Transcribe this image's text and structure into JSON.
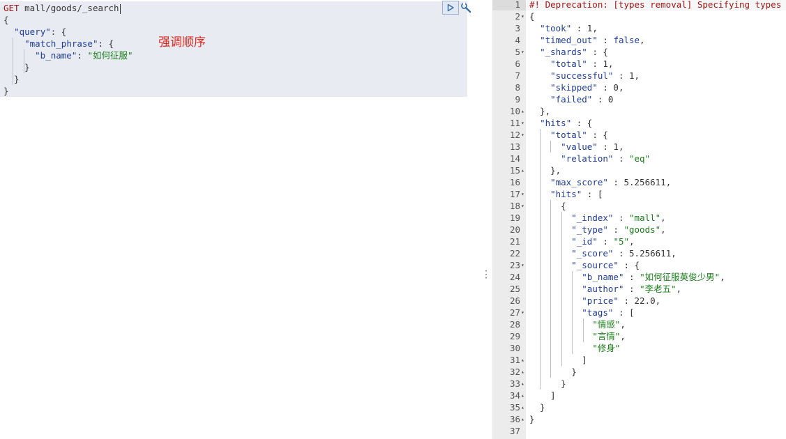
{
  "request": {
    "method": "GET",
    "path": "mall/goods/_search",
    "body_lines": [
      [
        {
          "t": "punc",
          "v": "{"
        }
      ],
      [
        {
          "t": "punc",
          "v": "  "
        },
        {
          "t": "key",
          "v": "\"query\""
        },
        {
          "t": "punc",
          "v": ": {"
        }
      ],
      [
        {
          "t": "punc",
          "v": "    "
        },
        {
          "t": "key",
          "v": "\"match_phrase\""
        },
        {
          "t": "punc",
          "v": ": {"
        }
      ],
      [
        {
          "t": "punc",
          "v": "      "
        },
        {
          "t": "key",
          "v": "\"b_name\""
        },
        {
          "t": "punc",
          "v": ": "
        },
        {
          "t": "str",
          "v": "\"如何征服\""
        }
      ],
      [
        {
          "t": "punc",
          "v": "    }"
        }
      ],
      [
        {
          "t": "punc",
          "v": "  }"
        }
      ],
      [
        {
          "t": "punc",
          "v": "}"
        }
      ]
    ]
  },
  "annotation": "强调顺序",
  "toolbar": {
    "run_icon": "play-icon",
    "settings_icon": "wrench-icon"
  },
  "colors": {
    "method": "#a31515",
    "key": "#1f3d99",
    "string": "#1a7f1a",
    "annotation": "#e0281f"
  },
  "response": {
    "lines": [
      {
        "n": "1",
        "f": "",
        "tokens": [
          {
            "t": "comment",
            "v": "#! Deprecation: [types removal] Specifying types in search requests is deprecated."
          }
        ]
      },
      {
        "n": "2",
        "f": "▾",
        "tokens": [
          {
            "t": "punc",
            "v": "{"
          }
        ]
      },
      {
        "n": "3",
        "f": "",
        "tokens": [
          {
            "t": "punc",
            "v": "  "
          },
          {
            "t": "key",
            "v": "\"took\""
          },
          {
            "t": "punc",
            "v": " : "
          },
          {
            "t": "num",
            "v": "1"
          },
          {
            "t": "punc",
            "v": ","
          }
        ]
      },
      {
        "n": "4",
        "f": "",
        "tokens": [
          {
            "t": "punc",
            "v": "  "
          },
          {
            "t": "key",
            "v": "\"timed_out\""
          },
          {
            "t": "punc",
            "v": " : "
          },
          {
            "t": "bool",
            "v": "false"
          },
          {
            "t": "punc",
            "v": ","
          }
        ]
      },
      {
        "n": "5",
        "f": "▾",
        "tokens": [
          {
            "t": "punc",
            "v": "  "
          },
          {
            "t": "key",
            "v": "\"_shards\""
          },
          {
            "t": "punc",
            "v": " : {"
          }
        ]
      },
      {
        "n": "6",
        "f": "",
        "tokens": [
          {
            "t": "punc",
            "v": "    "
          },
          {
            "t": "key",
            "v": "\"total\""
          },
          {
            "t": "punc",
            "v": " : "
          },
          {
            "t": "num",
            "v": "1"
          },
          {
            "t": "punc",
            "v": ","
          }
        ]
      },
      {
        "n": "7",
        "f": "",
        "tokens": [
          {
            "t": "punc",
            "v": "    "
          },
          {
            "t": "key",
            "v": "\"successful\""
          },
          {
            "t": "punc",
            "v": " : "
          },
          {
            "t": "num",
            "v": "1"
          },
          {
            "t": "punc",
            "v": ","
          }
        ]
      },
      {
        "n": "8",
        "f": "",
        "tokens": [
          {
            "t": "punc",
            "v": "    "
          },
          {
            "t": "key",
            "v": "\"skipped\""
          },
          {
            "t": "punc",
            "v": " : "
          },
          {
            "t": "num",
            "v": "0"
          },
          {
            "t": "punc",
            "v": ","
          }
        ]
      },
      {
        "n": "9",
        "f": "",
        "tokens": [
          {
            "t": "punc",
            "v": "    "
          },
          {
            "t": "key",
            "v": "\"failed\""
          },
          {
            "t": "punc",
            "v": " : "
          },
          {
            "t": "num",
            "v": "0"
          }
        ]
      },
      {
        "n": "10",
        "f": "▴",
        "tokens": [
          {
            "t": "punc",
            "v": "  },"
          }
        ]
      },
      {
        "n": "11",
        "f": "▾",
        "tokens": [
          {
            "t": "punc",
            "v": "  "
          },
          {
            "t": "key",
            "v": "\"hits\""
          },
          {
            "t": "punc",
            "v": " : {"
          }
        ]
      },
      {
        "n": "12",
        "f": "▾",
        "tokens": [
          {
            "t": "punc",
            "v": "    "
          },
          {
            "t": "key",
            "v": "\"total\""
          },
          {
            "t": "punc",
            "v": " : {"
          }
        ]
      },
      {
        "n": "13",
        "f": "",
        "tokens": [
          {
            "t": "punc",
            "v": "      "
          },
          {
            "t": "key",
            "v": "\"value\""
          },
          {
            "t": "punc",
            "v": " : "
          },
          {
            "t": "num",
            "v": "1"
          },
          {
            "t": "punc",
            "v": ","
          }
        ]
      },
      {
        "n": "14",
        "f": "",
        "tokens": [
          {
            "t": "punc",
            "v": "      "
          },
          {
            "t": "key",
            "v": "\"relation\""
          },
          {
            "t": "punc",
            "v": " : "
          },
          {
            "t": "str",
            "v": "\"eq\""
          }
        ]
      },
      {
        "n": "15",
        "f": "▴",
        "tokens": [
          {
            "t": "punc",
            "v": "    },"
          }
        ]
      },
      {
        "n": "16",
        "f": "",
        "tokens": [
          {
            "t": "punc",
            "v": "    "
          },
          {
            "t": "key",
            "v": "\"max_score\""
          },
          {
            "t": "punc",
            "v": " : "
          },
          {
            "t": "num",
            "v": "5.256611"
          },
          {
            "t": "punc",
            "v": ","
          }
        ]
      },
      {
        "n": "17",
        "f": "▾",
        "tokens": [
          {
            "t": "punc",
            "v": "    "
          },
          {
            "t": "key",
            "v": "\"hits\""
          },
          {
            "t": "punc",
            "v": " : ["
          }
        ]
      },
      {
        "n": "18",
        "f": "▾",
        "tokens": [
          {
            "t": "punc",
            "v": "      {"
          }
        ]
      },
      {
        "n": "19",
        "f": "",
        "tokens": [
          {
            "t": "punc",
            "v": "        "
          },
          {
            "t": "key",
            "v": "\"_index\""
          },
          {
            "t": "punc",
            "v": " : "
          },
          {
            "t": "str",
            "v": "\"mall\""
          },
          {
            "t": "punc",
            "v": ","
          }
        ]
      },
      {
        "n": "20",
        "f": "",
        "tokens": [
          {
            "t": "punc",
            "v": "        "
          },
          {
            "t": "key",
            "v": "\"_type\""
          },
          {
            "t": "punc",
            "v": " : "
          },
          {
            "t": "str",
            "v": "\"goods\""
          },
          {
            "t": "punc",
            "v": ","
          }
        ]
      },
      {
        "n": "21",
        "f": "",
        "tokens": [
          {
            "t": "punc",
            "v": "        "
          },
          {
            "t": "key",
            "v": "\"_id\""
          },
          {
            "t": "punc",
            "v": " : "
          },
          {
            "t": "str",
            "v": "\"5\""
          },
          {
            "t": "punc",
            "v": ","
          }
        ]
      },
      {
        "n": "22",
        "f": "",
        "tokens": [
          {
            "t": "punc",
            "v": "        "
          },
          {
            "t": "key",
            "v": "\"_score\""
          },
          {
            "t": "punc",
            "v": " : "
          },
          {
            "t": "num",
            "v": "5.256611"
          },
          {
            "t": "punc",
            "v": ","
          }
        ]
      },
      {
        "n": "23",
        "f": "▾",
        "tokens": [
          {
            "t": "punc",
            "v": "        "
          },
          {
            "t": "key",
            "v": "\"_source\""
          },
          {
            "t": "punc",
            "v": " : {"
          }
        ]
      },
      {
        "n": "24",
        "f": "",
        "tokens": [
          {
            "t": "punc",
            "v": "          "
          },
          {
            "t": "key",
            "v": "\"b_name\""
          },
          {
            "t": "punc",
            "v": " : "
          },
          {
            "t": "str",
            "v": "\"如何征服英俊少男\""
          },
          {
            "t": "punc",
            "v": ","
          }
        ]
      },
      {
        "n": "25",
        "f": "",
        "tokens": [
          {
            "t": "punc",
            "v": "          "
          },
          {
            "t": "key",
            "v": "\"author\""
          },
          {
            "t": "punc",
            "v": " : "
          },
          {
            "t": "str",
            "v": "\"李老五\""
          },
          {
            "t": "punc",
            "v": ","
          }
        ]
      },
      {
        "n": "26",
        "f": "",
        "tokens": [
          {
            "t": "punc",
            "v": "          "
          },
          {
            "t": "key",
            "v": "\"price\""
          },
          {
            "t": "punc",
            "v": " : "
          },
          {
            "t": "num",
            "v": "22.0"
          },
          {
            "t": "punc",
            "v": ","
          }
        ]
      },
      {
        "n": "27",
        "f": "▾",
        "tokens": [
          {
            "t": "punc",
            "v": "          "
          },
          {
            "t": "key",
            "v": "\"tags\""
          },
          {
            "t": "punc",
            "v": " : ["
          }
        ]
      },
      {
        "n": "28",
        "f": "",
        "tokens": [
          {
            "t": "punc",
            "v": "            "
          },
          {
            "t": "str",
            "v": "\"情感\""
          },
          {
            "t": "punc",
            "v": ","
          }
        ]
      },
      {
        "n": "29",
        "f": "",
        "tokens": [
          {
            "t": "punc",
            "v": "            "
          },
          {
            "t": "str",
            "v": "\"言情\""
          },
          {
            "t": "punc",
            "v": ","
          }
        ]
      },
      {
        "n": "30",
        "f": "",
        "tokens": [
          {
            "t": "punc",
            "v": "            "
          },
          {
            "t": "str",
            "v": "\"修身\""
          }
        ]
      },
      {
        "n": "31",
        "f": "▴",
        "tokens": [
          {
            "t": "punc",
            "v": "          ]"
          }
        ]
      },
      {
        "n": "32",
        "f": "▴",
        "tokens": [
          {
            "t": "punc",
            "v": "        }"
          }
        ]
      },
      {
        "n": "33",
        "f": "▴",
        "tokens": [
          {
            "t": "punc",
            "v": "      }"
          }
        ]
      },
      {
        "n": "34",
        "f": "▴",
        "tokens": [
          {
            "t": "punc",
            "v": "    ]"
          }
        ]
      },
      {
        "n": "35",
        "f": "▴",
        "tokens": [
          {
            "t": "punc",
            "v": "  }"
          }
        ]
      },
      {
        "n": "36",
        "f": "▴",
        "tokens": [
          {
            "t": "punc",
            "v": "}"
          }
        ]
      },
      {
        "n": "37",
        "f": "",
        "tokens": []
      }
    ]
  }
}
